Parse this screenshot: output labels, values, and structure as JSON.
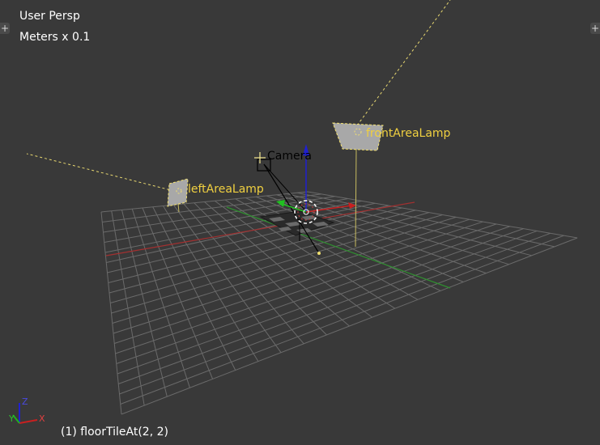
{
  "viewport": {
    "view_name": "User Persp",
    "unit_scale": "Meters x 0.1",
    "active_object": "(1) floorTileAt(2, 2)"
  },
  "objects": {
    "camera": "Camera",
    "front_lamp": "frontAreaLamp",
    "left_lamp": "leftAreaLamp"
  },
  "axis_gizmo": {
    "x": "X",
    "y": "Y",
    "z": "Z"
  },
  "controls": {
    "toolshelf_toggle": "+",
    "properties_toggle": "+"
  },
  "colors": {
    "background": "#393939",
    "grid": "#6a6a6a",
    "x_axis": "#a33030",
    "y_axis": "#2f8f2f",
    "z_axis": "#2020d0",
    "selected_label": "#f0d040",
    "lamp_line": "#e8d870"
  }
}
